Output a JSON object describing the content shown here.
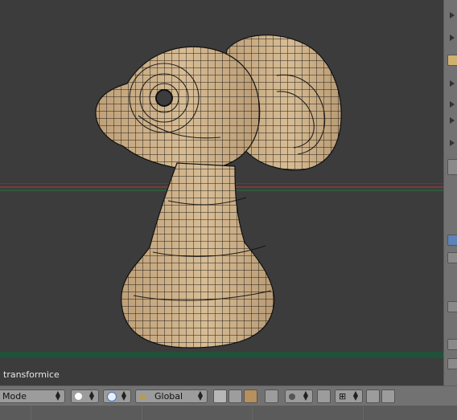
{
  "viewport": {
    "object_name": "transformice"
  },
  "toolbar": {
    "mode_label": "Mode",
    "orientation_label": "Global",
    "shading": "solid",
    "pivot": "pivot",
    "snap_icon": "magnet-icon"
  },
  "colors": {
    "viewport_bg": "#3c3c3c",
    "mesh_fill": "#c7aa82",
    "wire": "#111111",
    "x_axis": "#8a3a3a",
    "floor": "#21513a"
  }
}
